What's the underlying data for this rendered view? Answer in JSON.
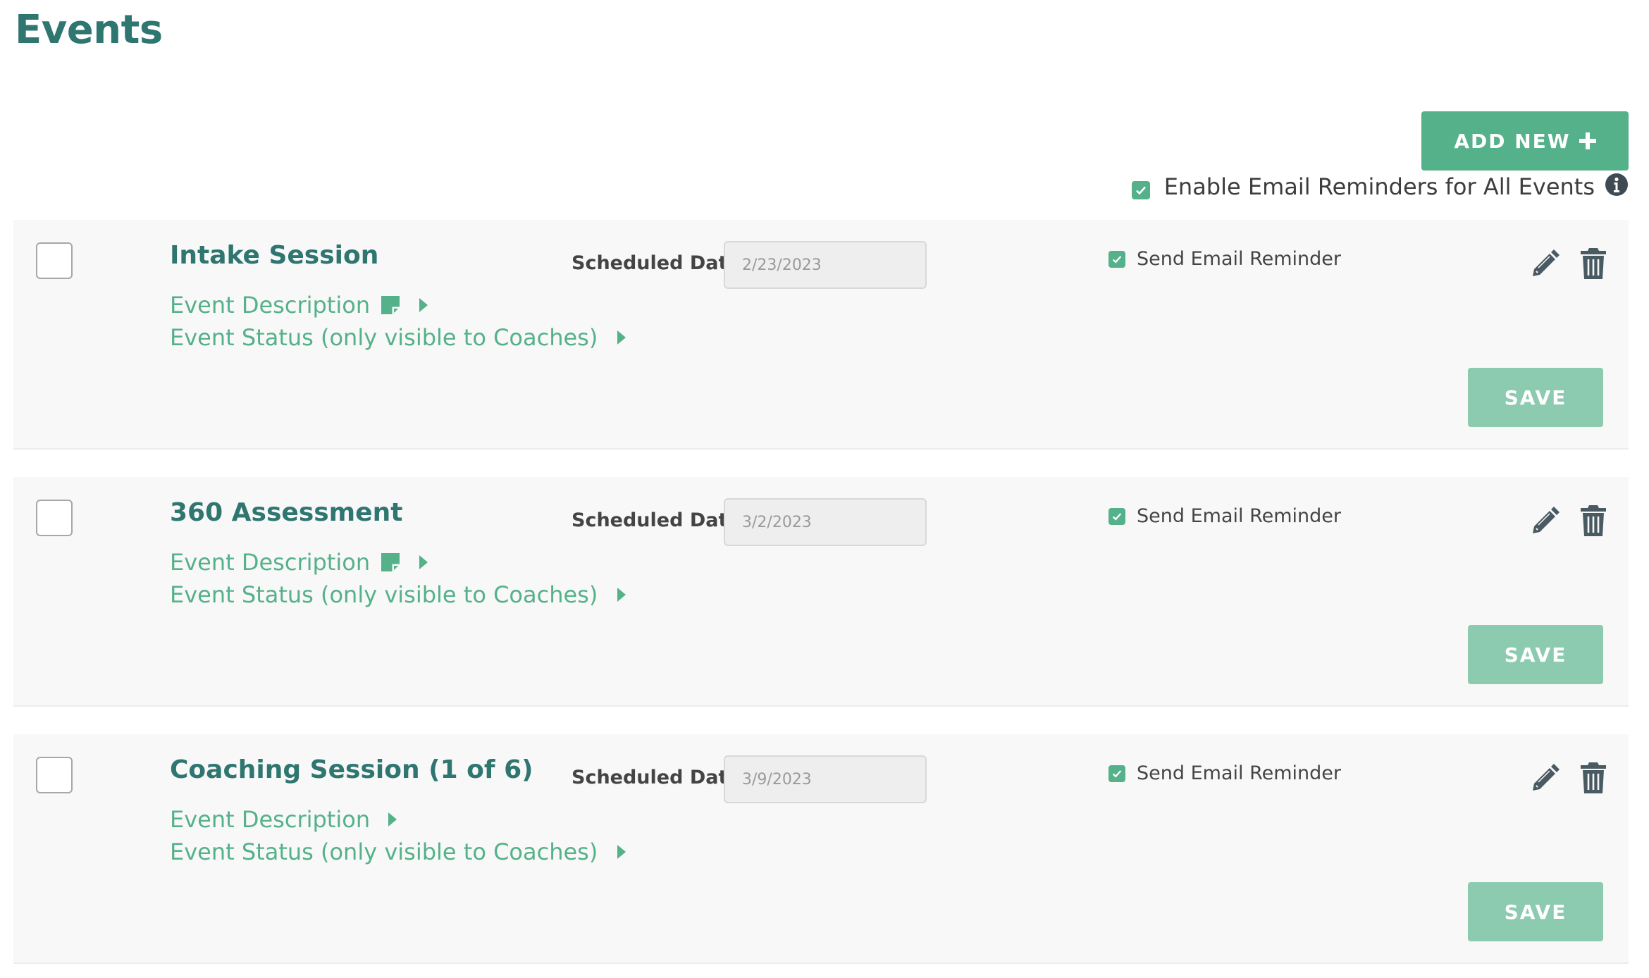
{
  "page": {
    "title": "Events"
  },
  "toolbar": {
    "add_new_label": "ADD NEW",
    "enable_all_label": "Enable Email Reminders for All Events",
    "enable_all_checked": true
  },
  "labels": {
    "scheduled_date": "Scheduled Date",
    "send_email_reminder": "Send Email Reminder",
    "event_description": "Event Description",
    "event_status": "Event Status (only visible to Coaches)",
    "save": "SAVE"
  },
  "events": [
    {
      "title": "Intake Session",
      "date": "2/23/2023",
      "send_reminder": true,
      "has_description_note": true
    },
    {
      "title": "360 Assessment",
      "date": "3/2/2023",
      "send_reminder": true,
      "has_description_note": true
    },
    {
      "title": "Coaching Session (1 of 6)",
      "date": "3/9/2023",
      "send_reminder": true,
      "has_description_note": false
    }
  ],
  "colors": {
    "title": "#2f7670",
    "accent": "#55b189",
    "save_disabled": "#8ccbb0",
    "icon": "#4a5a63"
  },
  "icons": {
    "add": "plus-icon",
    "info": "info-icon",
    "note": "note-icon",
    "expand": "caret-right-icon",
    "edit": "pencil-icon",
    "delete": "trash-icon",
    "check": "check-icon"
  }
}
